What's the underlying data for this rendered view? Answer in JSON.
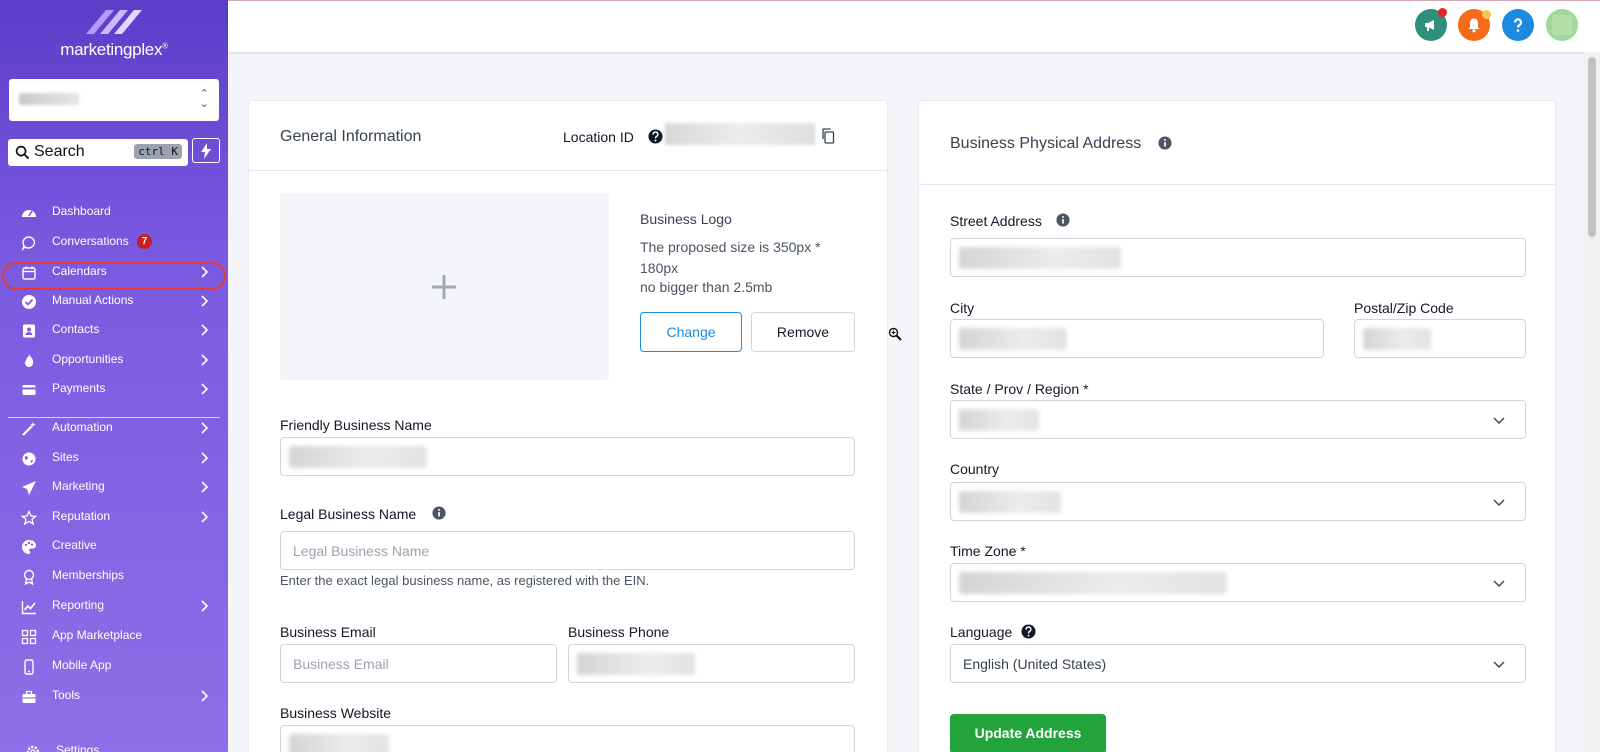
{
  "brand": {
    "name": "marketingplex"
  },
  "search": {
    "label": "Search",
    "shortcut": "ctrl K"
  },
  "sidebar": {
    "items": [
      {
        "label": "Dashboard",
        "icon": "dashboard-icon"
      },
      {
        "label": "Conversations",
        "icon": "chat-icon",
        "badge": "7"
      },
      {
        "label": "Calendars",
        "icon": "calendar-icon",
        "selected_highlight": true
      },
      {
        "label": "Manual Actions",
        "icon": "check-circle-icon"
      },
      {
        "label": "Contacts",
        "icon": "contact-card-icon"
      },
      {
        "label": "Opportunities",
        "icon": "flame-icon"
      },
      {
        "label": "Payments",
        "icon": "credit-card-icon"
      },
      {
        "label": "Automation",
        "icon": "magic-wand-icon"
      },
      {
        "label": "Sites",
        "icon": "globe-icon"
      },
      {
        "label": "Marketing",
        "icon": "paper-plane-icon"
      },
      {
        "label": "Reputation",
        "icon": "star-icon"
      },
      {
        "label": "Creative",
        "icon": "palette-icon"
      },
      {
        "label": "Memberships",
        "icon": "award-icon"
      },
      {
        "label": "Reporting",
        "icon": "line-chart-icon"
      },
      {
        "label": "App Marketplace",
        "icon": "grid-icon"
      },
      {
        "label": "Mobile App",
        "icon": "phone-icon"
      },
      {
        "label": "Tools",
        "icon": "toolbox-icon"
      },
      {
        "label": "Settings",
        "icon": "gear-icon"
      }
    ]
  },
  "general": {
    "title": "General Information",
    "location_id_label": "Location ID",
    "logo": {
      "title": "Business Logo",
      "size_hint": "The proposed size is 350px * 180px",
      "size_limit": "no bigger than 2.5mb",
      "change_label": "Change",
      "remove_label": "Remove"
    },
    "friendly_name_label": "Friendly Business Name",
    "legal_name_label": "Legal Business Name",
    "legal_name_placeholder": "Legal Business Name",
    "legal_name_help": "Enter the exact legal business name, as registered with the EIN.",
    "email_label": "Business Email",
    "email_placeholder": "Business Email",
    "phone_label": "Business Phone",
    "website_label": "Business Website"
  },
  "address": {
    "title": "Business Physical Address",
    "street_label": "Street Address",
    "city_label": "City",
    "zip_label": "Postal/Zip Code",
    "state_label": "State / Prov / Region *",
    "country_label": "Country",
    "timezone_label": "Time Zone *",
    "language_label": "Language",
    "language_value": "English (United States)",
    "update_label": "Update Address"
  },
  "colors": {
    "sidebar": "#6d4fd8",
    "primary_blue": "#1d8ae0",
    "update_green": "#23a33b",
    "highlight_red": "#e53935"
  }
}
